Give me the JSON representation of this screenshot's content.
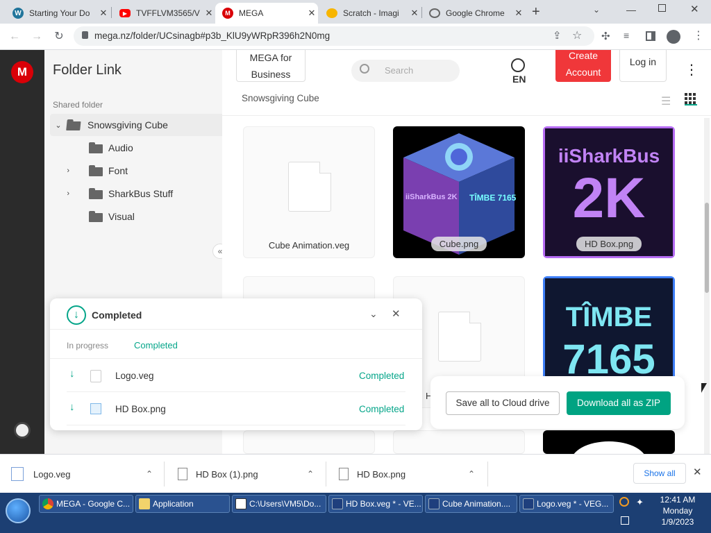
{
  "browser": {
    "tabs": [
      {
        "title": "Starting Your Do",
        "icon": "wordpress-icon"
      },
      {
        "title": "TVFFLVM3565/V",
        "icon": "youtube-icon"
      },
      {
        "title": "MEGA",
        "icon": "mega-icon"
      },
      {
        "title": "Scratch - Imagi",
        "icon": "scratch-icon"
      },
      {
        "title": "Google Chrome",
        "icon": "chrome-icon"
      }
    ],
    "url": "mega.nz/folder/UCsinagb#p3b_KlU9yWRpR396h2N0mg"
  },
  "header": {
    "business": "MEGA for Business",
    "search_placeholder": "Search",
    "language": "EN",
    "create_account": "Create Account",
    "login": "Log in"
  },
  "sidebar": {
    "title": "Folder Link",
    "section": "Shared folder",
    "root": "Snowsgiving Cube",
    "items": [
      {
        "label": "Audio",
        "expandable": false
      },
      {
        "label": "Font",
        "expandable": true
      },
      {
        "label": "SharkBus Stuff",
        "expandable": true
      },
      {
        "label": "Visual",
        "expandable": false
      }
    ]
  },
  "main": {
    "breadcrumb": "Snowsgiving Cube",
    "files": [
      {
        "name": "Cube Animation.veg"
      },
      {
        "name": "Cube.png",
        "text_left": "iiSharkBus 2K",
        "text_right": "TÎMBE 7165"
      },
      {
        "name": "HD Box.png",
        "text_top": "iiSharkBus",
        "text_big": "2K"
      },
      {
        "name": "",
        "text_top": "TÎMBE",
        "text_big": "7165"
      }
    ],
    "partial_label": "H"
  },
  "transfers": {
    "title": "Completed",
    "tab_in_progress": "In progress",
    "tab_completed": "Completed",
    "rows": [
      {
        "name": "Logo.veg",
        "status": "Completed"
      },
      {
        "name": "HD Box.png",
        "status": "Completed"
      }
    ]
  },
  "actions": {
    "save_cloud": "Save all to Cloud drive",
    "download_zip": "Download all as ZIP"
  },
  "downloads": {
    "items": [
      "Logo.veg",
      "HD Box (1).png",
      "HD Box.png"
    ],
    "show_all": "Show all"
  },
  "taskbar": {
    "items": [
      {
        "label": "MEGA - Google C...",
        "icon": "chrome-icon"
      },
      {
        "label": "Application",
        "icon": "folder-icon"
      },
      {
        "label": "C:\\Users\\VM5\\Do...",
        "icon": "7zip-icon"
      },
      {
        "label": "HD Box.veg * - VE...",
        "icon": "vegas-icon"
      },
      {
        "label": "Cube Animation....",
        "icon": "vegas-icon"
      },
      {
        "label": "Logo.veg * - VEG...",
        "icon": "vegas-icon"
      }
    ],
    "time": "12:41 AM",
    "day": "Monday",
    "date": "1/9/2023"
  },
  "colors": {
    "mega_red": "#d90007",
    "mega_red_button": "#f0373a",
    "teal": "#04a589",
    "teal_dark": "#00a382",
    "purple": "#b66cf3"
  }
}
